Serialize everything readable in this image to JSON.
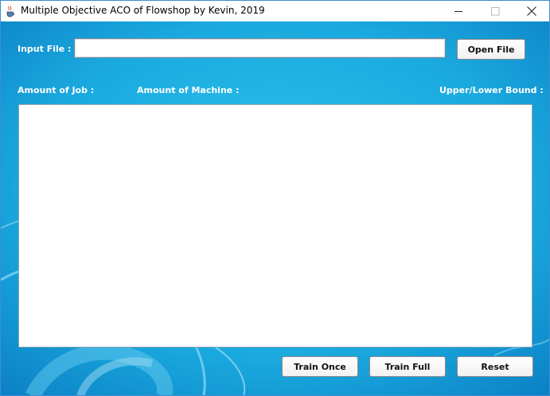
{
  "window": {
    "title": "Multiple Objective ACO of Flowshop by Kevin, 2019"
  },
  "icons": {
    "app": "java-cup-icon",
    "minimize": "minimize-icon",
    "maximize": "maximize-icon",
    "close": "close-icon"
  },
  "form": {
    "input_file_label": "Input File :",
    "input_file_value": "",
    "open_file_label": "Open File"
  },
  "info": {
    "job_label": "Amount of Job :",
    "machine_label": "Amount of Machine :",
    "bound_label": "Upper/Lower Bound :"
  },
  "output": {
    "text": ""
  },
  "actions": {
    "train_once_label": "Train Once",
    "train_full_label": "Train Full",
    "reset_label": "Reset"
  },
  "colors": {
    "background": "#1aa7dc",
    "label_text": "#ffffff"
  }
}
